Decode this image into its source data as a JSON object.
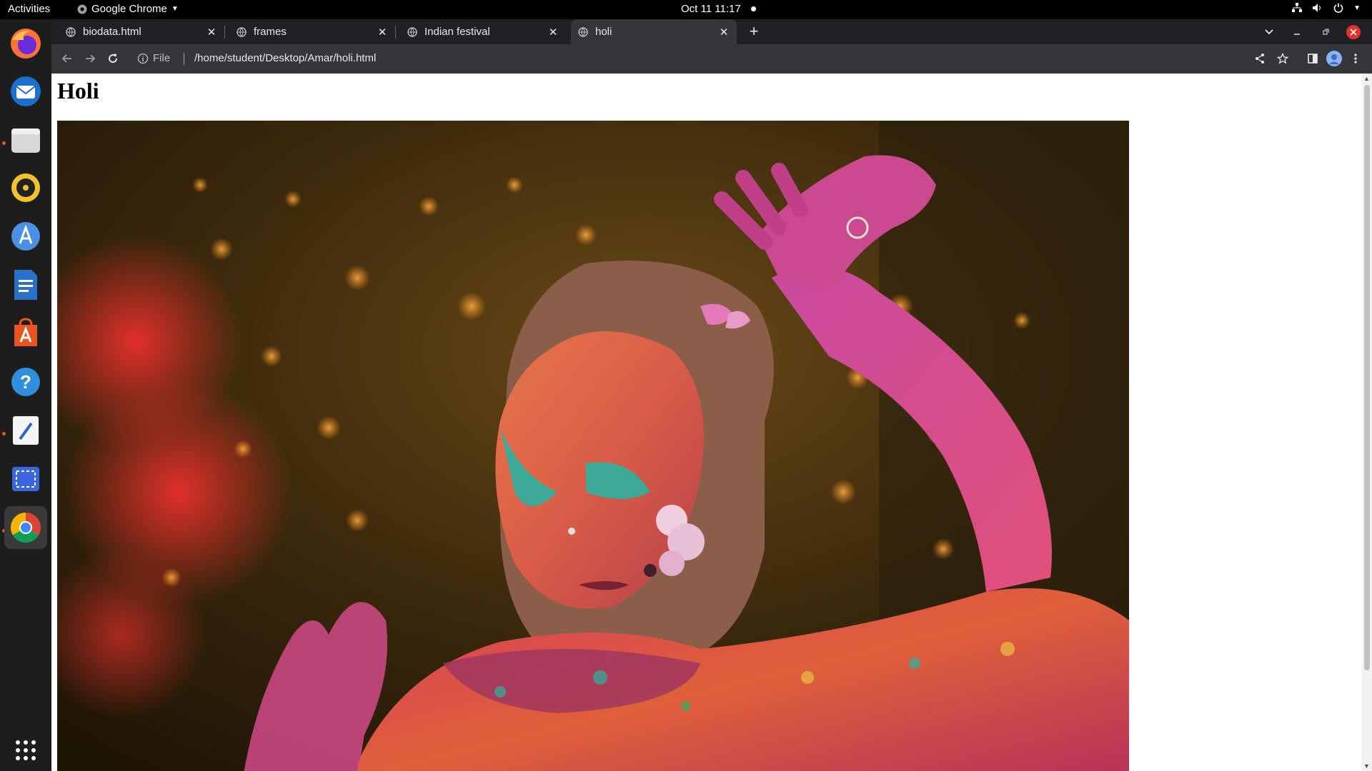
{
  "topbar": {
    "activities": "Activities",
    "app_name": "Google Chrome",
    "clock": "Oct 11  11:17"
  },
  "dock": {
    "items": [
      "firefox-icon",
      "thunderbird-icon",
      "files-icon",
      "rhythmbox-icon",
      "app-center-icon",
      "libreoffice-writer-icon",
      "ubuntu-software-icon",
      "help-icon",
      "text-editor-icon",
      "screenshot-icon",
      "chrome-icon",
      "show-applications-icon"
    ]
  },
  "tabs": [
    {
      "label": "biodata.html"
    },
    {
      "label": "frames"
    },
    {
      "label": "Indian festival"
    },
    {
      "label": "holi"
    }
  ],
  "omnibox": {
    "scheme": "File",
    "url": "/home/student/Desktop/Amar/holi.html"
  },
  "page": {
    "heading": "Holi"
  },
  "colors": {
    "tabstrip": "#202124",
    "toolbar": "#35363a",
    "accent_close": "#e4322b",
    "ubuntu_orange": "#e95420"
  }
}
